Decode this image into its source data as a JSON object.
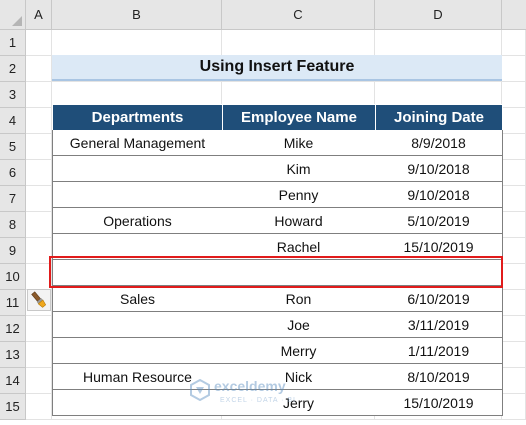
{
  "columns": [
    "A",
    "B",
    "C",
    "D"
  ],
  "rows": [
    "1",
    "2",
    "3",
    "4",
    "5",
    "6",
    "7",
    "8",
    "9",
    "10",
    "11",
    "12",
    "13",
    "14",
    "15"
  ],
  "title": "Using Insert Feature",
  "table": {
    "headers": [
      "Departments",
      "Employee Name",
      "Joining Date"
    ],
    "rows": [
      {
        "department": "General Management",
        "name": "Mike",
        "date": "8/9/2018"
      },
      {
        "department": "",
        "name": "Kim",
        "date": "9/10/2018"
      },
      {
        "department": "",
        "name": "Penny",
        "date": "9/10/2018"
      },
      {
        "department": "Operations",
        "name": "Howard",
        "date": "5/10/2019"
      },
      {
        "department": "",
        "name": "Rachel",
        "date": "15/10/2019"
      },
      {
        "department": "",
        "name": "",
        "date": ""
      },
      {
        "department": "Sales",
        "name": "Ron",
        "date": "6/10/2019"
      },
      {
        "department": "",
        "name": "Joe",
        "date": "3/11/2019"
      },
      {
        "department": "",
        "name": "Merry",
        "date": "1/11/2019"
      },
      {
        "department": "Human Resource",
        "name": "Nick",
        "date": "8/10/2019"
      },
      {
        "department": "",
        "name": "Jerry",
        "date": "15/10/2019"
      }
    ]
  },
  "highlight_row": "10",
  "icons": {
    "format_painter": "paintbrush-icon"
  },
  "watermark": {
    "name": "exceldemy",
    "sub": "EXCEL · DATA · BI"
  },
  "colors": {
    "header_fill": "#1f4e79",
    "title_fill": "#dce9f6",
    "highlight": "#e11b1b"
  }
}
